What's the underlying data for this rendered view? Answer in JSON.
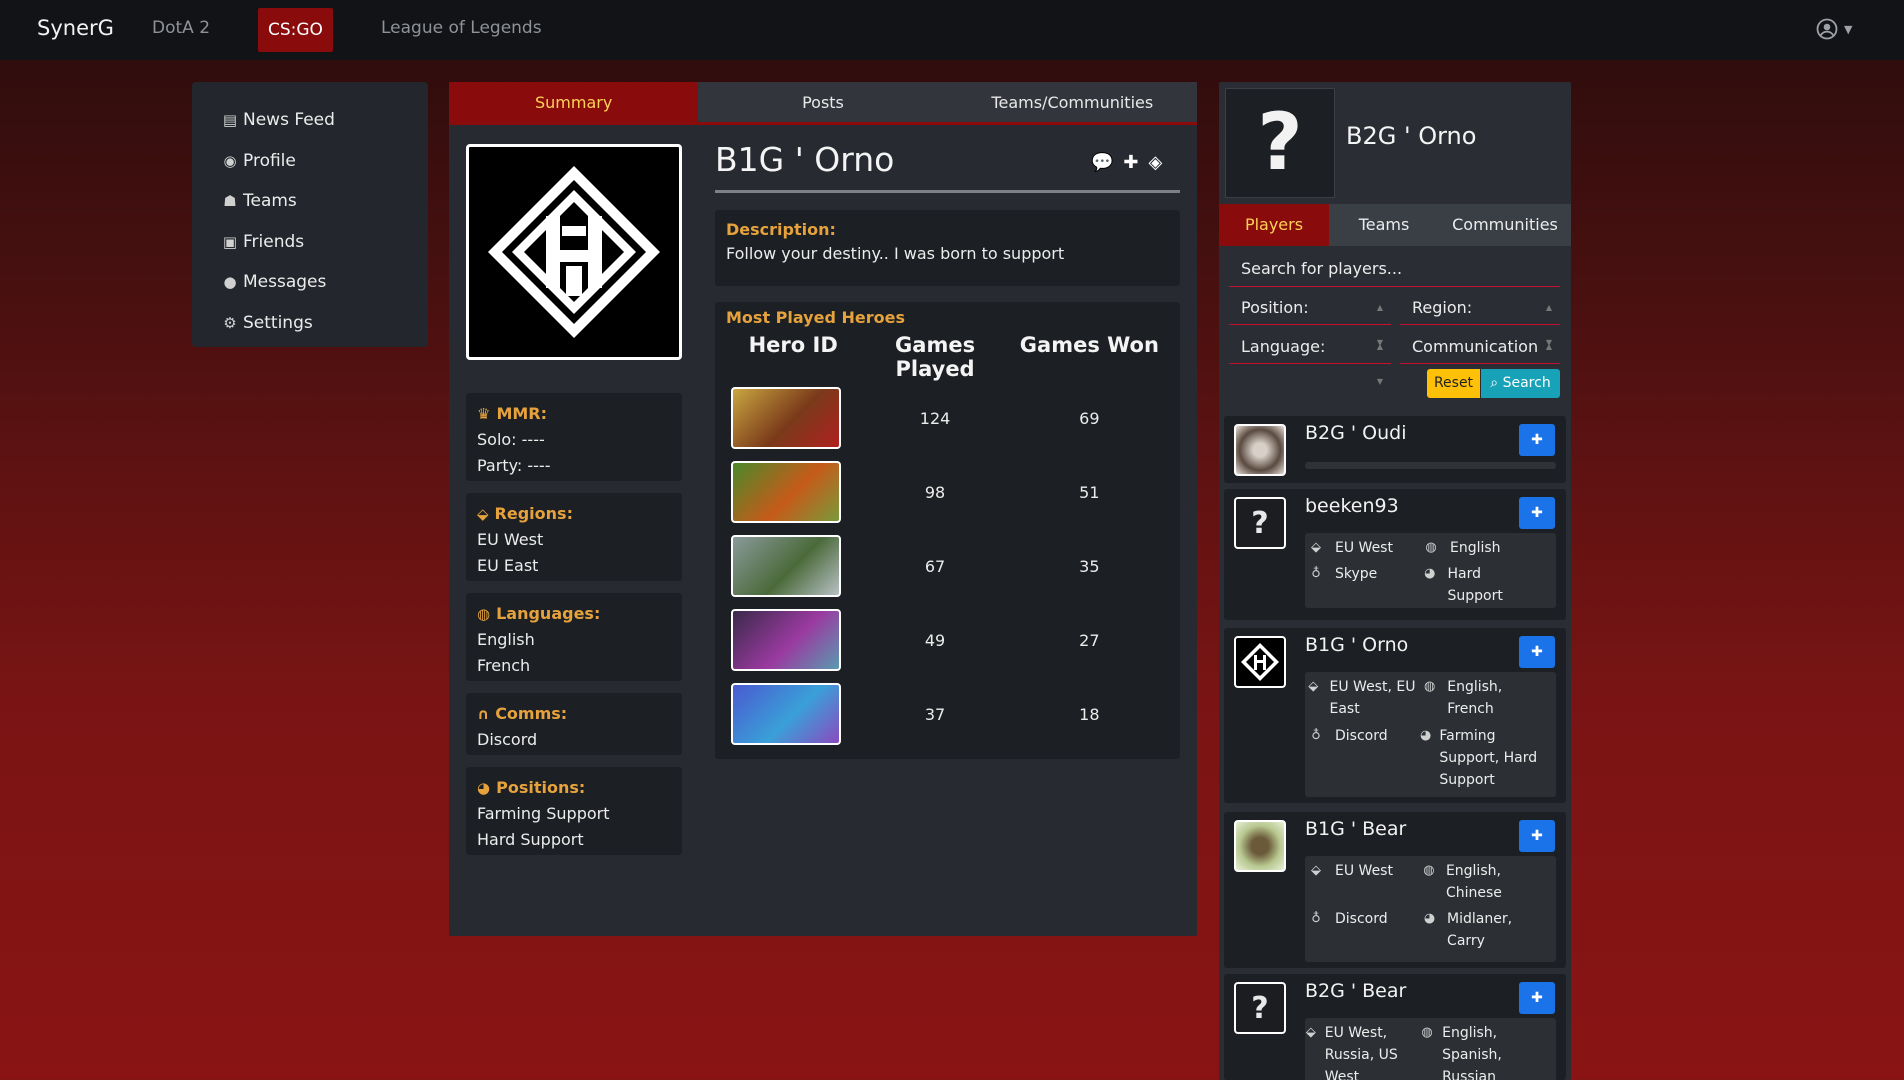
{
  "nav": {
    "brand": "SynerG",
    "links": [
      "DotA 2",
      "CS:GO",
      "League of Legends"
    ],
    "active": "CS:GO"
  },
  "sidebar": {
    "items": [
      {
        "label": "News Feed",
        "icon": "newspaper-icon"
      },
      {
        "label": "Profile",
        "icon": "user-circle-icon"
      },
      {
        "label": "Teams",
        "icon": "users-icon"
      },
      {
        "label": "Friends",
        "icon": "address-book-icon"
      },
      {
        "label": "Messages",
        "icon": "comments-icon"
      },
      {
        "label": "Settings",
        "icon": "gear-icon"
      }
    ]
  },
  "profile": {
    "tabs": [
      "Summary",
      "Posts",
      "Teams/Communities"
    ],
    "name": "B1G ' Orno",
    "description_label": "Description:",
    "description": "Follow your destiny.. I was born to support",
    "mmr": {
      "title": "MMR:",
      "solo": "Solo: ----",
      "party": "Party: ----"
    },
    "regions": {
      "title": "Regions:",
      "items": [
        "EU West",
        "EU East"
      ]
    },
    "languages": {
      "title": "Languages:",
      "items": [
        "English",
        "French"
      ]
    },
    "comms": {
      "title": "Comms:",
      "items": [
        "Discord"
      ]
    },
    "positions": {
      "title": "Positions:",
      "items": [
        "Farming Support",
        "Hard Support"
      ]
    },
    "heroes": {
      "title": "Most Played Heroes",
      "headers": [
        "Hero ID",
        "Games Played",
        "Games Won"
      ],
      "rows": [
        {
          "played": "124",
          "won": "69"
        },
        {
          "played": "98",
          "won": "51"
        },
        {
          "played": "67",
          "won": "35"
        },
        {
          "played": "49",
          "won": "27"
        },
        {
          "played": "37",
          "won": "18"
        }
      ]
    }
  },
  "search_panel": {
    "name": "B2G ' Orno",
    "avatar_text": "?",
    "tabs": [
      "Players",
      "Teams",
      "Communities"
    ],
    "search_placeholder": "Search for players...",
    "filters": {
      "position": "Position:",
      "region": "Region:",
      "language": "Language:",
      "communication": "Communication"
    },
    "reset_label": "Reset",
    "search_label": "Search",
    "players": [
      {
        "name": "B2G ' Oudi"
      },
      {
        "name": "beeken93",
        "region": "EU West",
        "language": "English",
        "comm": "Skype",
        "position": "Hard Support"
      },
      {
        "name": "B1G ' Orno",
        "region": "EU West, EU East",
        "language": "English, French",
        "comm": "Discord",
        "position": "Farming Support, Hard Support"
      },
      {
        "name": "B1G ' Bear",
        "region": "EU West",
        "language": "English, Chinese",
        "comm": "Discord",
        "position": "Midlaner, Carry"
      },
      {
        "name": "B2G ' Bear",
        "region": "EU West, Russia, US West",
        "language": "English, Spanish, Russian"
      }
    ]
  },
  "colors": {
    "accent": "#8a0b0b",
    "gold": "#e6a23c",
    "primary_button": "#1a73e8",
    "warning_button": "#ffc107",
    "info_button": "#17a2b8"
  }
}
